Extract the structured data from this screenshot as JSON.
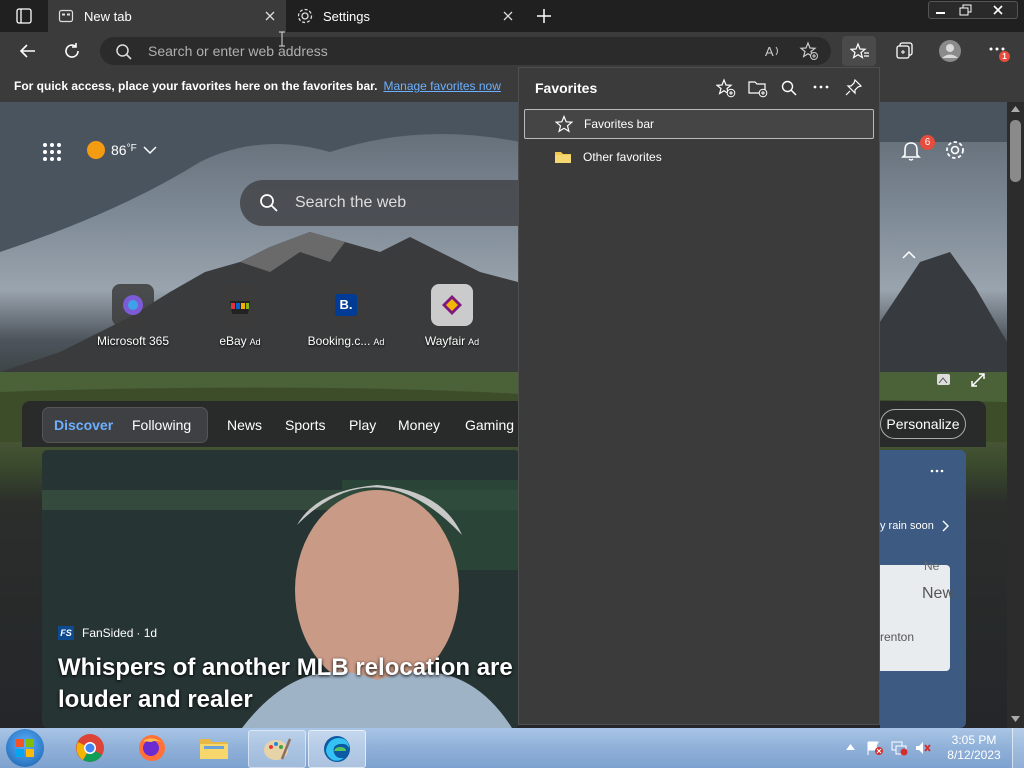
{
  "browser": {
    "tabs": [
      {
        "label": "New tab",
        "active": true
      },
      {
        "label": "Settings",
        "active": false
      }
    ],
    "address_bar": {
      "placeholder": "Search or enter web address",
      "value": ""
    },
    "favorites_bar_hint": {
      "text": "For quick access, place your favorites here on the favorites bar.",
      "link": "Manage favorites now"
    },
    "notification_badge": "1"
  },
  "ntp": {
    "weather": {
      "temp": "86",
      "unit": "°F"
    },
    "search_placeholder": "Search the web",
    "notifications_count": "6",
    "quick_links": [
      {
        "label": "Microsoft 365",
        "ad": ""
      },
      {
        "label": "eBay",
        "ad": "Ad"
      },
      {
        "label": "Booking.c...",
        "ad": "Ad"
      },
      {
        "label": "Wayfair",
        "ad": "Ad"
      }
    ],
    "feed_tabs": [
      "Discover",
      "Following",
      "News",
      "Sports",
      "Play",
      "Money",
      "Gaming"
    ],
    "personalize_label": "Personalize",
    "headline": {
      "source": "FanSided",
      "age": "· 1d",
      "title_line1": "Whispers of another MLB relocation are ge",
      "title_line2": "louder and realer"
    },
    "weather_card": {
      "text": "y rain soon",
      "map_label_1": "Ne",
      "map_label_2": "New",
      "map_label_3": "renton"
    }
  },
  "favorites_panel": {
    "title": "Favorites",
    "items": [
      {
        "label": "Favorites bar",
        "icon": "star-outline-icon"
      },
      {
        "label": "Other favorites",
        "icon": "folder-icon"
      }
    ]
  },
  "taskbar": {
    "time": "3:05 PM",
    "date": "8/12/2023",
    "apps": [
      "start-orb",
      "chrome",
      "firefox",
      "file-explorer",
      "paint",
      "edge"
    ]
  },
  "colors": {
    "accent_link": "#6cb0ff",
    "notification_red": "#e74c3c",
    "panel_bg": "#3b3b3b"
  }
}
